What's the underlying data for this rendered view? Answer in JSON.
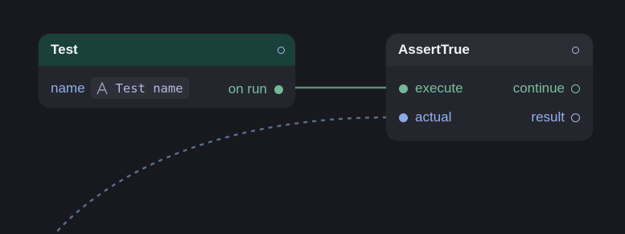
{
  "nodes": {
    "test": {
      "title": "Test",
      "field_label": "name",
      "field_value": "Test name",
      "output_label": "on run"
    },
    "assert": {
      "title": "AssertTrue",
      "inputs": [
        "execute",
        "actual"
      ],
      "outputs": [
        "continue",
        "result"
      ]
    }
  },
  "colors": {
    "background": "#17191e",
    "node_body": "#24262d",
    "test_header": "#19403a",
    "exec_wire": "#5c8f78",
    "data_wire": "#5b6e8f",
    "exec_port": "#74b897",
    "data_port": "#8aaae9"
  },
  "icons": {
    "text_type": "text-type-icon"
  }
}
